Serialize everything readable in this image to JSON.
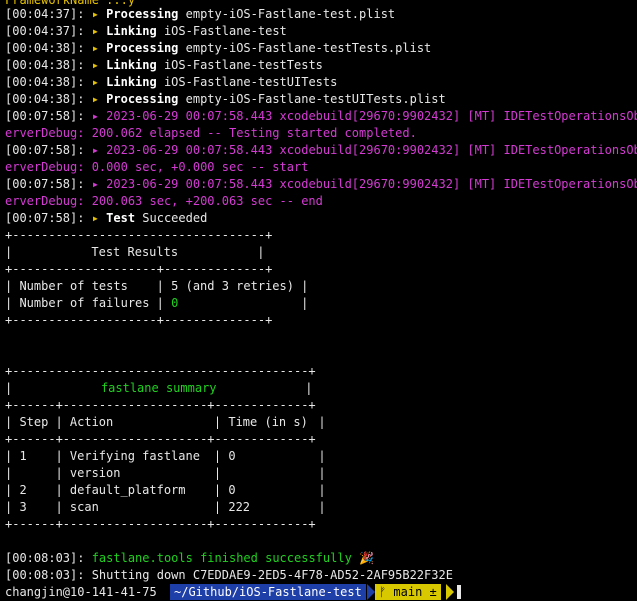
{
  "top_partial": "FrameworkName ...y",
  "log": [
    {
      "ts": "[00:04:37]: ",
      "action": "Processing",
      "arg": " empty-iOS-Fastlane-test.plist"
    },
    {
      "ts": "[00:04:37]: ",
      "action": "Linking",
      "arg": " iOS-Fastlane-test"
    },
    {
      "ts": "[00:04:38]: ",
      "action": "Processing",
      "arg": " empty-iOS-Fastlane-testTests.plist"
    },
    {
      "ts": "[00:04:38]: ",
      "action": "Linking",
      "arg": " iOS-Fastlane-testTests"
    },
    {
      "ts": "[00:04:38]: ",
      "action": "Linking",
      "arg": " iOS-Fastlane-testUITests"
    },
    {
      "ts": "[00:04:38]: ",
      "action": "Processing",
      "arg": " empty-iOS-Fastlane-testUITests.plist"
    }
  ],
  "debug": [
    {
      "ts": "[00:07:58]: ",
      "l1": "2023-06-29 00:07:58.443 xcodebuild[29670:9902432] [MT] IDETestOperationsObs",
      "l2": "erverDebug: 200.062 elapsed -- Testing started completed."
    },
    {
      "ts": "[00:07:58]: ",
      "l1": "2023-06-29 00:07:58.443 xcodebuild[29670:9902432] [MT] IDETestOperationsObs",
      "l2": "erverDebug: 0.000 sec, +0.000 sec -- start"
    },
    {
      "ts": "[00:07:58]: ",
      "l1": "2023-06-29 00:07:58.443 xcodebuild[29670:9902432] [MT] IDETestOperationsObs",
      "l2": "erverDebug: 200.063 sec, +200.063 sec -- end"
    }
  ],
  "test_line": {
    "ts": "[00:07:58]: ",
    "action": "Test",
    "arg": " Succeeded"
  },
  "bullet": "▸ ",
  "results": {
    "title": "Test Results",
    "rows": [
      {
        "label": "Number of tests",
        "value": "5 (and 3 retries)"
      },
      {
        "label": "Number of failures",
        "value": "0"
      }
    ]
  },
  "summary": {
    "title": "fastlane summary",
    "headers": {
      "step": "Step",
      "action": "Action",
      "time": "Time (in s)"
    },
    "rows": [
      {
        "step": "1",
        "action": "Verifying fastlane",
        "time": "0"
      },
      {
        "step": "",
        "action": "version",
        "time": ""
      },
      {
        "step": "2",
        "action": "default_platform",
        "time": "0"
      },
      {
        "step": "3",
        "action": "scan",
        "time": "222"
      }
    ]
  },
  "finish": {
    "ts": "[00:08:03]: ",
    "msg": "fastlane.tools finished successfully",
    "emoji": "🎉"
  },
  "shutdown": {
    "ts": "[00:08:03]: ",
    "msg": "Shutting down C7EDDAE9-2ED5-4F78-AD52-2AF95B22F32E"
  },
  "prompt": {
    "user": "changjin@10-141-41-75",
    "dir": "~/Github/iOS-Fastlane-test",
    "branch": "ᚠ main ±"
  },
  "colors": {
    "magenta": "#d33bd3",
    "green": "#20d020",
    "yellow": "#e5c100",
    "prompt_dir": "#1e3ea8",
    "prompt_git": "#d8c800"
  }
}
